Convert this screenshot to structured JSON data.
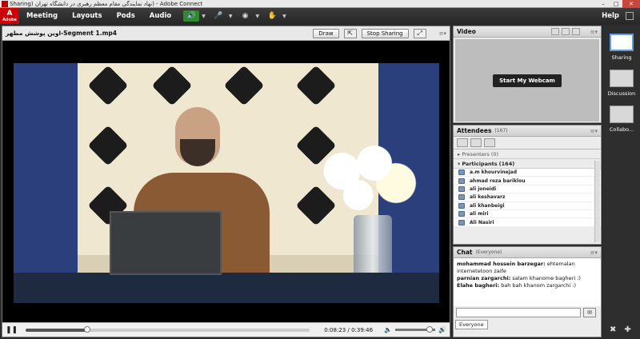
{
  "window": {
    "title": "Sharing) نهاد نمایندگی مقام معظم رهبری در دانشگاه تهران) - Adobe Connect"
  },
  "menubar": {
    "logo_line1": "A",
    "logo_line2": "Adobe",
    "items": [
      "Meeting",
      "Layouts",
      "Pods",
      "Audio"
    ],
    "help": "Help"
  },
  "share_pod": {
    "title": "اوین پوشش مطهر-Segment 1.mp4",
    "draw_button": "Draw",
    "stop_sharing_button": "Stop Sharing",
    "playback": {
      "current_time": "0:08:23",
      "total_time": "0:39:46",
      "progress": 0.21,
      "volume": 0.85
    }
  },
  "video_pod": {
    "title": "Video",
    "webcam_button": "Start My Webcam"
  },
  "attendees_pod": {
    "title": "Attendees",
    "count": "(167)",
    "presenters_label": "Presenters",
    "presenters_count": "(0)",
    "participants_label": "Participants",
    "participants_count": "(164)",
    "participants": [
      "a.m khourvinejad",
      "ahmad reza bariklou",
      "ali joneidi",
      "ali keshavarz",
      "ali khanbeigi",
      "ali miri",
      "Ali Nasiri"
    ]
  },
  "chat_pod": {
    "title": "Chat",
    "scope": "(Everyone)",
    "messages": [
      {
        "sender": "mohammad hossein barzegar:",
        "text": " ehtemalan internetetoon zaife"
      },
      {
        "sender": "parnian zargarchi:",
        "text": " salam khanome bagheri :)"
      },
      {
        "sender": "Elahe bagheri:",
        "text": " bah bah khanom zargarchi :)"
      }
    ],
    "tab_label": "Everyone"
  },
  "layouts": [
    {
      "label": "Sharing",
      "selected": true
    },
    {
      "label": "Discussion",
      "selected": false
    },
    {
      "label": "Collabo...",
      "selected": false
    }
  ],
  "colors": {
    "audio_on": "#2f8a2f",
    "menubar": "#262626",
    "selected_layout": "#5aa0e0"
  }
}
